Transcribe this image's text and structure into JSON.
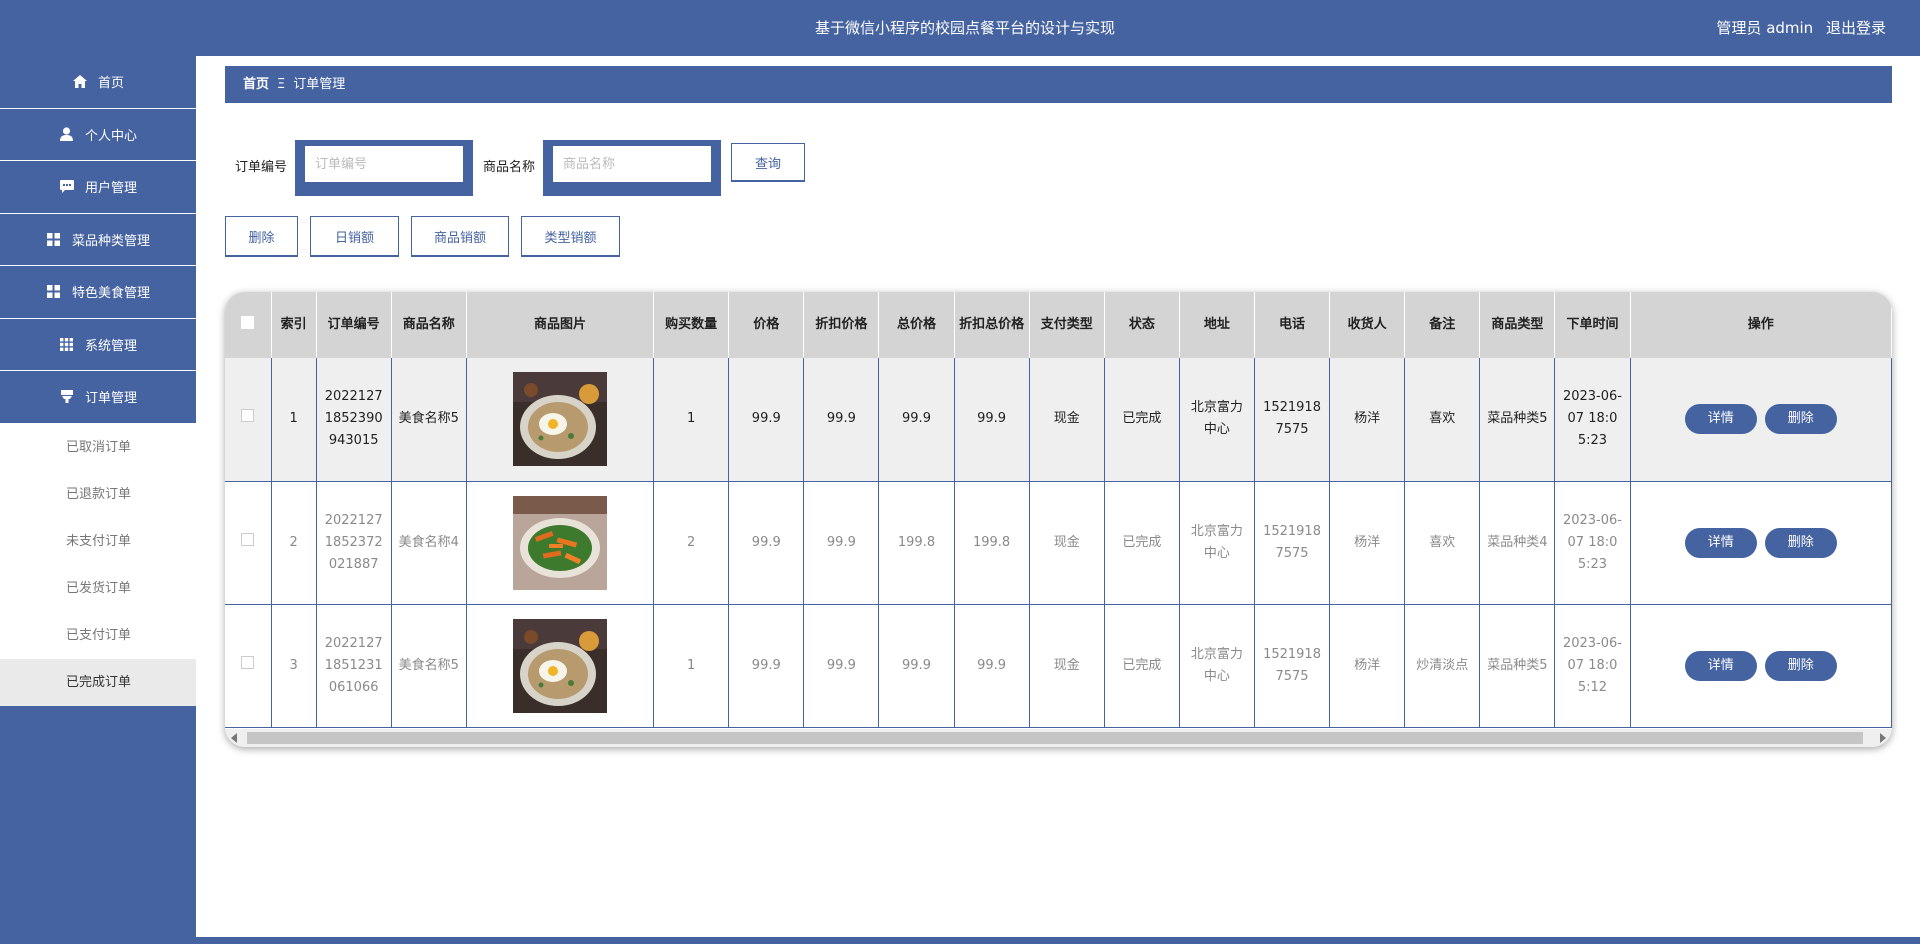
{
  "header": {
    "title": "基于微信小程序的校园点餐平台的设计与实现",
    "user_label": "管理员 admin",
    "logout_label": "退出登录"
  },
  "sidebar": {
    "items": [
      {
        "label": "首页",
        "icon": "home-icon"
      },
      {
        "label": "个人中心",
        "icon": "person-icon"
      },
      {
        "label": "用户管理",
        "icon": "chat-icon"
      },
      {
        "label": "菜品种类管理",
        "icon": "grid-icon"
      },
      {
        "label": "特色美食管理",
        "icon": "grid-icon"
      },
      {
        "label": "系统管理",
        "icon": "apps-icon"
      },
      {
        "label": "订单管理",
        "icon": "funnel-icon"
      }
    ],
    "subitems": [
      "已取消订单",
      "已退款订单",
      "未支付订单",
      "已发货订单",
      "已支付订单",
      "已完成订单"
    ]
  },
  "breadcrumb": {
    "home": "首页",
    "separator": "Ξ",
    "current": "订单管理"
  },
  "search": {
    "order_no_label": "订单编号",
    "order_no_placeholder": "订单编号",
    "goods_name_label": "商品名称",
    "goods_name_placeholder": "商品名称",
    "query_button": "查询"
  },
  "actions": {
    "delete": "删除",
    "daily_sales": "日销额",
    "goods_sales": "商品销额",
    "type_sales": "类型销额"
  },
  "table": {
    "headers": [
      "索引",
      "订单编号",
      "商品名称",
      "商品图片",
      "购买数量",
      "价格",
      "折扣价格",
      "总价格",
      "折扣总价格",
      "支付类型",
      "状态",
      "地址",
      "电话",
      "收货人",
      "备注",
      "商品类型",
      "下单时间",
      "操作"
    ],
    "rows": [
      {
        "index": "1",
        "order_no": "20221271852390943015",
        "goods_name": "美食名称5",
        "image": "fried-rice-egg-photo",
        "qty": "1",
        "price": "99.9",
        "discount_price": "99.9",
        "total": "99.9",
        "discount_total": "99.9",
        "pay_type": "现金",
        "status": "已完成",
        "address": "北京富力中心",
        "phone": "15219187575",
        "receiver": "杨洋",
        "remark": "喜欢",
        "goods_type": "菜品种类5",
        "order_time": "2023-06-07 18:05:23"
      },
      {
        "index": "2",
        "order_no": "20221271852372021887",
        "goods_name": "美食名称4",
        "image": "carrot-greens-dish-photo",
        "qty": "2",
        "price": "99.9",
        "discount_price": "99.9",
        "total": "199.8",
        "discount_total": "199.8",
        "pay_type": "现金",
        "status": "已完成",
        "address": "北京富力中心",
        "phone": "15219187575",
        "receiver": "杨洋",
        "remark": "喜欢",
        "goods_type": "菜品种类4",
        "order_time": "2023-06-07 18:05:23"
      },
      {
        "index": "3",
        "order_no": "20221271851231061066",
        "goods_name": "美食名称5",
        "image": "fried-rice-egg-photo",
        "qty": "1",
        "price": "99.9",
        "discount_price": "99.9",
        "total": "99.9",
        "discount_total": "99.9",
        "pay_type": "现金",
        "status": "已完成",
        "address": "北京富力中心",
        "phone": "15219187575",
        "receiver": "杨洋",
        "remark": "炒清淡点",
        "goods_type": "菜品种类5",
        "order_time": "2023-06-07 18:05:12"
      }
    ],
    "detail_button": "详情",
    "delete_button": "删除"
  },
  "colors": {
    "primary": "#4562a1",
    "header_bg": "#d4d4d4",
    "row_highlight": "#efefef"
  }
}
